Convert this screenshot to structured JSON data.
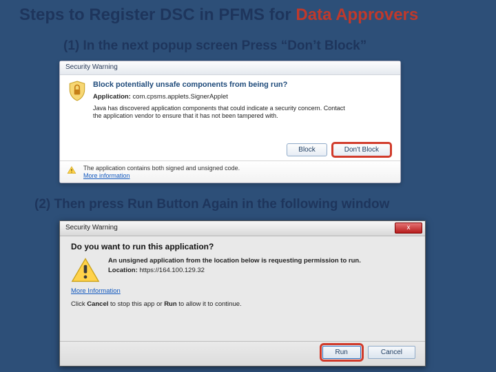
{
  "title_a": "Steps to Register DSC in PFMS for ",
  "title_b": "Data Approvers",
  "steps": {
    "1": "(1) In the next popup screen Press “Don’t Block”",
    "2": "(2) Then press Run Button Again in the following window"
  },
  "dlg1": {
    "title": "Security Warning",
    "question": "Block potentially unsafe components from being run?",
    "app_label": "Application:",
    "app_value": "com.cpsms.applets.SignerApplet",
    "desc": "Java has discovered application components that could indicate a security concern. Contact the application vendor to ensure that it has not been tampered with.",
    "btn_block": "Block",
    "btn_dont_block": "Don't Block",
    "warn_text": "The application contains both signed and unsigned code.",
    "more_info": "More information"
  },
  "dlg2": {
    "title": "Security Warning",
    "close_glyph": "x",
    "question": "Do you want to run this application?",
    "lead": "An unsigned application from the location below is requesting permission to run.",
    "loc_label": "Location:",
    "loc_value": "https://164.100.129.32",
    "more_info": "More Information",
    "cancel_a": "Click ",
    "cancel_b": "Cancel",
    "cancel_c": " to stop this app or ",
    "cancel_d": "Run",
    "cancel_e": " to allow it to continue.",
    "btn_run": "Run",
    "btn_cancel": "Cancel"
  }
}
